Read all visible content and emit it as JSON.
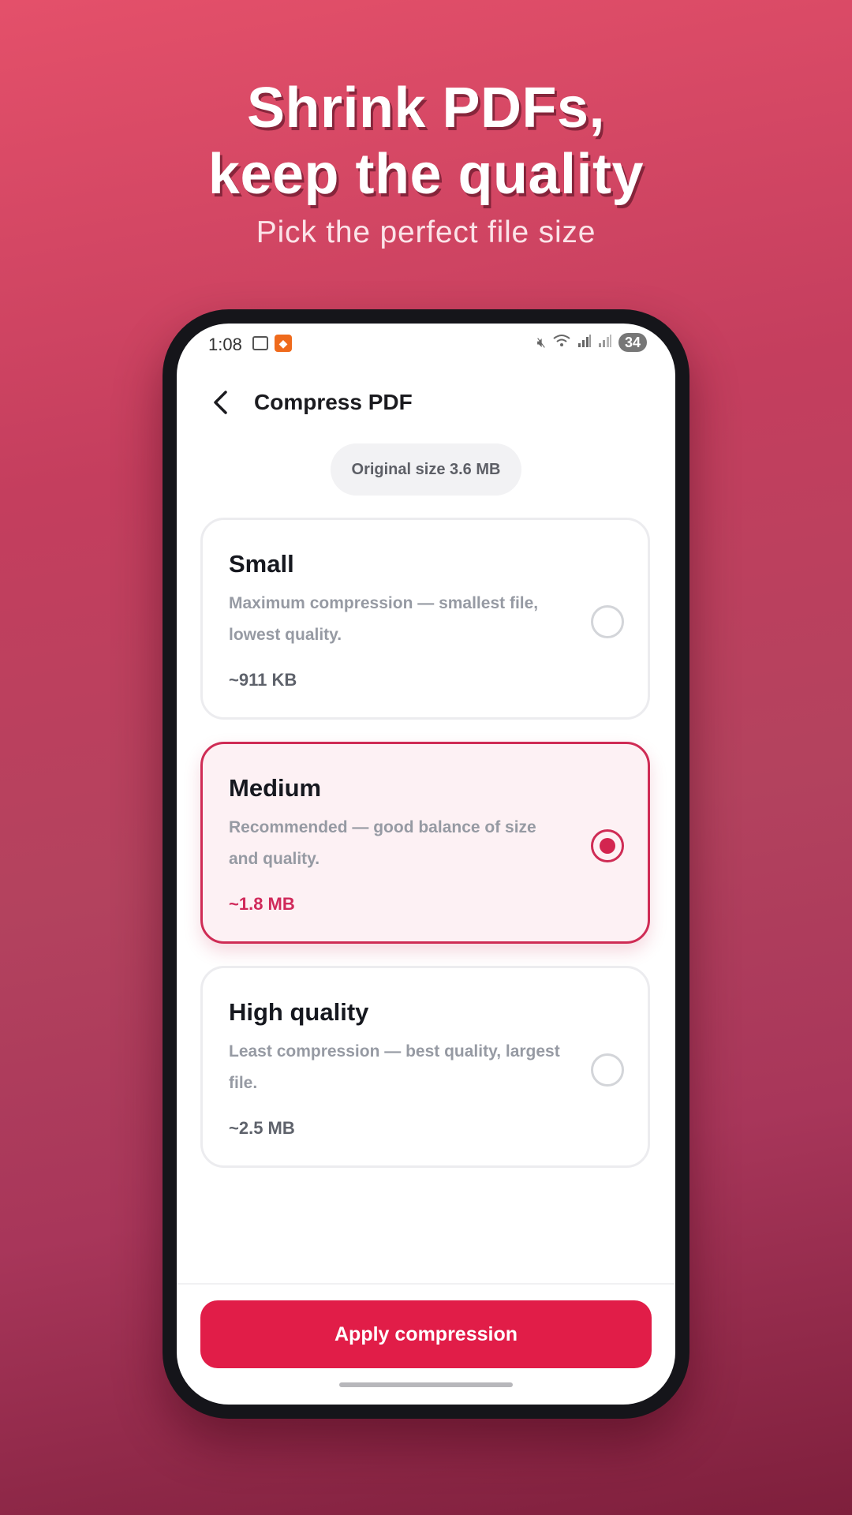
{
  "hero": {
    "title_line1": "Shrink PDFs,",
    "title_line2": "keep the quality",
    "subtitle": "Pick the perfect file size"
  },
  "status_bar": {
    "time": "1:08",
    "battery": "34"
  },
  "app_bar": {
    "title": "Compress PDF"
  },
  "original_size": "Original size 3.6 MB",
  "options": [
    {
      "title": "Small",
      "description": "Maximum compression — smallest file, lowest quality.",
      "size": "~911 KB",
      "selected": false
    },
    {
      "title": "Medium",
      "description": "Recommended — good balance of size and quality.",
      "size": "~1.8 MB",
      "selected": true
    },
    {
      "title": "High quality",
      "description": "Least compression — best quality, largest file.",
      "size": "~2.5 MB",
      "selected": false
    }
  ],
  "apply_button": "Apply compression",
  "colors": {
    "accent": "#e11d48",
    "selected_border": "#cf2c55",
    "selected_bg": "#fdf1f4"
  }
}
